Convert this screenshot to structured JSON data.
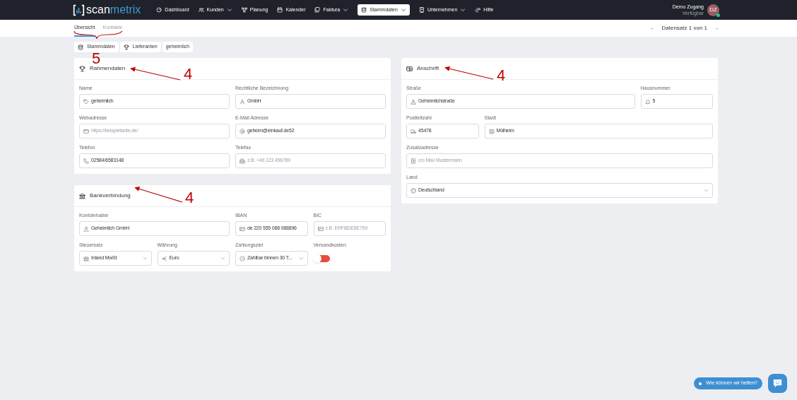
{
  "nav": {
    "logo": {
      "part_a": "scan",
      "part_b": "metrix"
    },
    "items": [
      {
        "label": "Dashboard",
        "dropdown": false,
        "selected": false
      },
      {
        "label": "Kunden",
        "dropdown": true,
        "selected": false
      },
      {
        "label": "Planung",
        "dropdown": false,
        "selected": false
      },
      {
        "label": "Kalender",
        "dropdown": false,
        "selected": false
      },
      {
        "label": "Faktura",
        "dropdown": true,
        "selected": false
      },
      {
        "label": "Stammdaten",
        "dropdown": true,
        "selected": true
      },
      {
        "label": "Unternehmen",
        "dropdown": true,
        "selected": false
      },
      {
        "label": "Hilfe",
        "dropdown": false,
        "selected": false
      }
    ],
    "user": {
      "name": "Demo Zugang",
      "status": "Verfügbar",
      "initials": "DZ",
      "online": true
    }
  },
  "view_tabs": [
    {
      "label": "Übersicht",
      "selected": true
    },
    {
      "label": "Kontakte",
      "selected": false
    }
  ],
  "pager": {
    "prev": "←",
    "text": "Datensatz 1 von 1",
    "next": "→"
  },
  "section_tabs": [
    {
      "label": "Stammdaten"
    },
    {
      "label": "Lieferanten"
    },
    {
      "label": "geheimlich"
    }
  ],
  "cards": [
    {
      "title": "Rahmendaten",
      "fields": [
        {
          "kind": "input",
          "label": "Name",
          "value": "geheimlich"
        },
        {
          "kind": "input",
          "label": "Rechtliche Bezeichnung",
          "value": "GmbH"
        },
        {
          "kind": "input",
          "label": "Webadresse",
          "placeholder": "https://beispielseite.de/"
        },
        {
          "kind": "input",
          "label": "E-Mail Adresse",
          "value": "geheim@einkauf.de52"
        },
        {
          "kind": "input",
          "label": "Telefon",
          "value": "02584/6583148"
        },
        {
          "kind": "input",
          "label": "Telefax",
          "placeholder": "z.B. +49 123 456789"
        }
      ]
    },
    {
      "title": "Bankverbindung",
      "fields": [
        {
          "kind": "input",
          "label": "Kontoinhaber",
          "value": "Geheimlich GmbH"
        },
        {
          "kind": "input",
          "label": "IBAN",
          "value": "de 220 555 088 088896"
        },
        {
          "kind": "input",
          "label": "BIC",
          "placeholder": "z.B. ERFBDE8E759"
        },
        {
          "kind": "select",
          "label": "Steuersatz",
          "value": "Inland MwSt"
        },
        {
          "kind": "select",
          "label": "Währung",
          "value": "Euro"
        },
        {
          "kind": "select",
          "label": "Zahlungsziel",
          "value": "Zahlbar binnen 30 T..."
        },
        {
          "kind": "toggle",
          "label": "Versandkosten",
          "on": false
        }
      ]
    },
    {
      "title": "Anschrift",
      "fields": [
        {
          "kind": "input",
          "label": "Straße",
          "value": "Geheimlichstraße"
        },
        {
          "kind": "input",
          "label": "Hausnummer",
          "value": "5"
        },
        {
          "kind": "input",
          "label": "Postleitzahl",
          "value": "45478"
        },
        {
          "kind": "input",
          "label": "Stadt",
          "value": "Mülheim"
        },
        {
          "kind": "input",
          "label": "Zusatzadresse",
          "placeholder": "c/o Max Mustermann"
        },
        {
          "kind": "select",
          "label": "Land",
          "value": "Deutschland"
        }
      ]
    }
  ],
  "chat": {
    "label": "Wie können wir helfen?"
  },
  "annotations": [
    {
      "text": "5"
    },
    {
      "text": "4"
    },
    {
      "text": "4"
    },
    {
      "text": "4"
    }
  ]
}
